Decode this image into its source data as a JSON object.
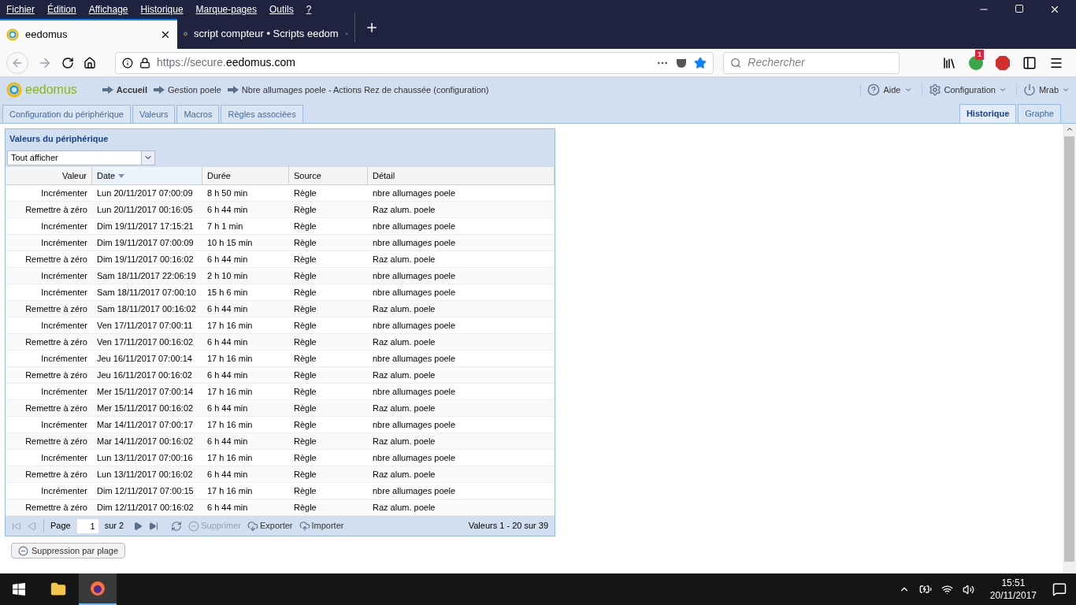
{
  "menu_bar": [
    "Fichier",
    "Édition",
    "Affichage",
    "Historique",
    "Marque-pages",
    "Outils",
    "?"
  ],
  "browser_tabs": [
    {
      "title": "eedomus",
      "selected": true
    },
    {
      "title": "script compteur • Scripts eedom",
      "selected": false
    }
  ],
  "address_bar": {
    "url_prefix": "https://secure.",
    "url_domain": "eedomus.com"
  },
  "search": {
    "placeholder": "Rechercher"
  },
  "extension_badge": "1",
  "app_header": {
    "logo": "eedomus",
    "breadcrumbs": [
      {
        "label": "Accueil",
        "bold": true
      },
      {
        "label": "Gestion poele",
        "bold": false
      },
      {
        "label": "Nbre allumages poele - Actions Rez de chaussée (configuration)",
        "bold": false
      }
    ],
    "menus": [
      "Aide",
      "Configuration",
      "Mrab"
    ]
  },
  "page_tabs": [
    {
      "label": "Configuration du périphérique",
      "selected": false
    },
    {
      "label": "Valeurs",
      "selected": false
    },
    {
      "label": "Macros",
      "selected": false
    },
    {
      "label": "Règles associées",
      "selected": false
    }
  ],
  "right_tabs": [
    {
      "label": "Historique",
      "selected": true
    },
    {
      "label": "Graphe",
      "selected": false
    }
  ],
  "panel": {
    "title": "Valeurs du périphérique",
    "filter": "Tout afficher",
    "columns": [
      "Valeur",
      "Date",
      "Durée",
      "Source",
      "Détail"
    ],
    "rows": [
      [
        "Incrémenter",
        "Lun 20/11/2017 07:00:09",
        "8 h 50 min",
        "Règle",
        "nbre allumages poele"
      ],
      [
        "Remettre à zéro",
        "Lun 20/11/2017 00:16:05",
        "6 h 44 min",
        "Règle",
        "Raz alum. poele"
      ],
      [
        "Incrémenter",
        "Dim 19/11/2017 17:15:21",
        "7 h 1 min",
        "Règle",
        "nbre allumages poele"
      ],
      [
        "Incrémenter",
        "Dim 19/11/2017 07:00:09",
        "10 h 15 min",
        "Règle",
        "nbre allumages poele"
      ],
      [
        "Remettre à zéro",
        "Dim 19/11/2017 00:16:02",
        "6 h 44 min",
        "Règle",
        "Raz alum. poele"
      ],
      [
        "Incrémenter",
        "Sam 18/11/2017 22:06:19",
        "2 h 10 min",
        "Règle",
        "nbre allumages poele"
      ],
      [
        "Incrémenter",
        "Sam 18/11/2017 07:00:10",
        "15 h 6 min",
        "Règle",
        "nbre allumages poele"
      ],
      [
        "Remettre à zéro",
        "Sam 18/11/2017 00:16:02",
        "6 h 44 min",
        "Règle",
        "Raz alum. poele"
      ],
      [
        "Incrémenter",
        "Ven 17/11/2017 07:00:11",
        "17 h 16 min",
        "Règle",
        "nbre allumages poele"
      ],
      [
        "Remettre à zéro",
        "Ven 17/11/2017 00:16:02",
        "6 h 44 min",
        "Règle",
        "Raz alum. poele"
      ],
      [
        "Incrémenter",
        "Jeu 16/11/2017 07:00:14",
        "17 h 16 min",
        "Règle",
        "nbre allumages poele"
      ],
      [
        "Remettre à zéro",
        "Jeu 16/11/2017 00:16:02",
        "6 h 44 min",
        "Règle",
        "Raz alum. poele"
      ],
      [
        "Incrémenter",
        "Mer 15/11/2017 07:00:14",
        "17 h 16 min",
        "Règle",
        "nbre allumages poele"
      ],
      [
        "Remettre à zéro",
        "Mer 15/11/2017 00:16:02",
        "6 h 44 min",
        "Règle",
        "Raz alum. poele"
      ],
      [
        "Incrémenter",
        "Mar 14/11/2017 07:00:17",
        "17 h 16 min",
        "Règle",
        "nbre allumages poele"
      ],
      [
        "Remettre à zéro",
        "Mar 14/11/2017 00:16:02",
        "6 h 44 min",
        "Règle",
        "Raz alum. poele"
      ],
      [
        "Incrémenter",
        "Lun 13/11/2017 07:00:16",
        "17 h 16 min",
        "Règle",
        "nbre allumages poele"
      ],
      [
        "Remettre à zéro",
        "Lun 13/11/2017 00:16:02",
        "6 h 44 min",
        "Règle",
        "Raz alum. poele"
      ],
      [
        "Incrémenter",
        "Dim 12/11/2017 07:00:15",
        "17 h 16 min",
        "Règle",
        "nbre allumages poele"
      ],
      [
        "Remettre à zéro",
        "Dim 12/11/2017 00:16:02",
        "6 h 44 min",
        "Règle",
        "Raz alum. poele"
      ]
    ],
    "pager": {
      "page_label": "Page",
      "page": "1",
      "of": "sur 2",
      "actions": [
        {
          "label": "Supprimer",
          "disabled": true
        },
        {
          "label": "Exporter",
          "disabled": false
        },
        {
          "label": "Importer",
          "disabled": false
        }
      ],
      "summary": "Valeurs 1 - 20 sur 39"
    }
  },
  "range_delete_button": "Suppression par plage",
  "clock": {
    "time": "15:51",
    "date": "20/11/2017"
  }
}
